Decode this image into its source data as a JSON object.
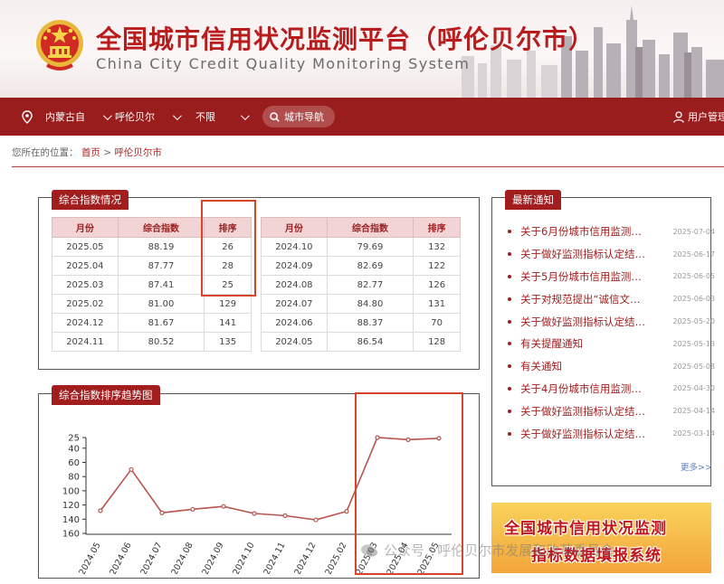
{
  "header": {
    "title_cn": "全国城市信用状况监测平台（呼伦贝尔市）",
    "title_en": "China City Credit Quality Monitoring System",
    "emblem_icon": "national-emblem-icon",
    "brand_color": "#a21e1e"
  },
  "nav": {
    "province": "内蒙古自",
    "city": "呼伦贝尔",
    "district": "不限",
    "city_nav": "城市导航",
    "user_admin": "用户管理"
  },
  "breadcrumb": {
    "prefix": "您所在的位置：",
    "home": "首页",
    "separator": ">",
    "current": "呼伦贝尔市"
  },
  "index_panel": {
    "title": "综合指数情况",
    "headers": [
      "月份",
      "综合指数",
      "排序"
    ],
    "left_rows": [
      [
        "2025.05",
        "88.19",
        "26"
      ],
      [
        "2025.04",
        "87.77",
        "28"
      ],
      [
        "2025.03",
        "87.41",
        "25"
      ],
      [
        "2025.02",
        "81.00",
        "129"
      ],
      [
        "2024.12",
        "81.67",
        "141"
      ],
      [
        "2024.11",
        "80.52",
        "135"
      ]
    ],
    "right_rows": [
      [
        "2024.10",
        "79.69",
        "132"
      ],
      [
        "2024.09",
        "82.69",
        "122"
      ],
      [
        "2024.08",
        "82.77",
        "126"
      ],
      [
        "2024.07",
        "84.80",
        "131"
      ],
      [
        "2024.06",
        "88.37",
        "70"
      ],
      [
        "2024.05",
        "86.54",
        "128"
      ]
    ]
  },
  "trend_panel": {
    "title": "综合指数排序趋势图"
  },
  "chart_data": {
    "type": "line",
    "categories": [
      "2024.05",
      "2024.06",
      "2024.07",
      "2024.08",
      "2024.09",
      "2024.10",
      "2024.11",
      "2024.12",
      "2025.02",
      "2025.03",
      "2025.04",
      "2025.05"
    ],
    "series": [
      {
        "values": [
          128,
          70,
          131,
          126,
          122,
          132,
          135,
          141,
          129,
          25,
          28,
          26
        ]
      }
    ],
    "y_ticks": [
      25,
      40,
      60,
      80,
      100,
      120,
      140,
      160
    ],
    "ylim": [
      25,
      160
    ],
    "y_inverted": true,
    "title": "",
    "xlabel": "",
    "ylabel": "",
    "line_color": "#b85450",
    "grid": false
  },
  "notices": {
    "title": "最新通知",
    "items": [
      {
        "text": "关于6月份城市信用监测…",
        "date": "2025-07-04"
      },
      {
        "text": "关于做好监测指标认定结…",
        "date": "2025-06-17"
      },
      {
        "text": "关于5月份城市信用监测…",
        "date": "2025-06-05"
      },
      {
        "text": "关于对规范提出“诚信文…",
        "date": "2025-06-03"
      },
      {
        "text": "关于做好监测指标认定结…",
        "date": "2025-05-20"
      },
      {
        "text": "有关提醒通知",
        "date": "2025-05-13"
      },
      {
        "text": "有关通知",
        "date": "2025-05-08"
      },
      {
        "text": "关于4月份城市信用监测…",
        "date": "2025-04-30"
      },
      {
        "text": "关于做好监测指标认定结…",
        "date": "2025-04-14"
      },
      {
        "text": "关于做好监测指标认定结…",
        "date": "2025-03-14"
      }
    ],
    "more": "更多>>"
  },
  "banner": {
    "line1": "全国城市信用状况监测",
    "line2": "指标数据填报系统"
  },
  "watermark": {
    "text": "公众号 · 呼伦贝尔市发展和改革委员会"
  }
}
